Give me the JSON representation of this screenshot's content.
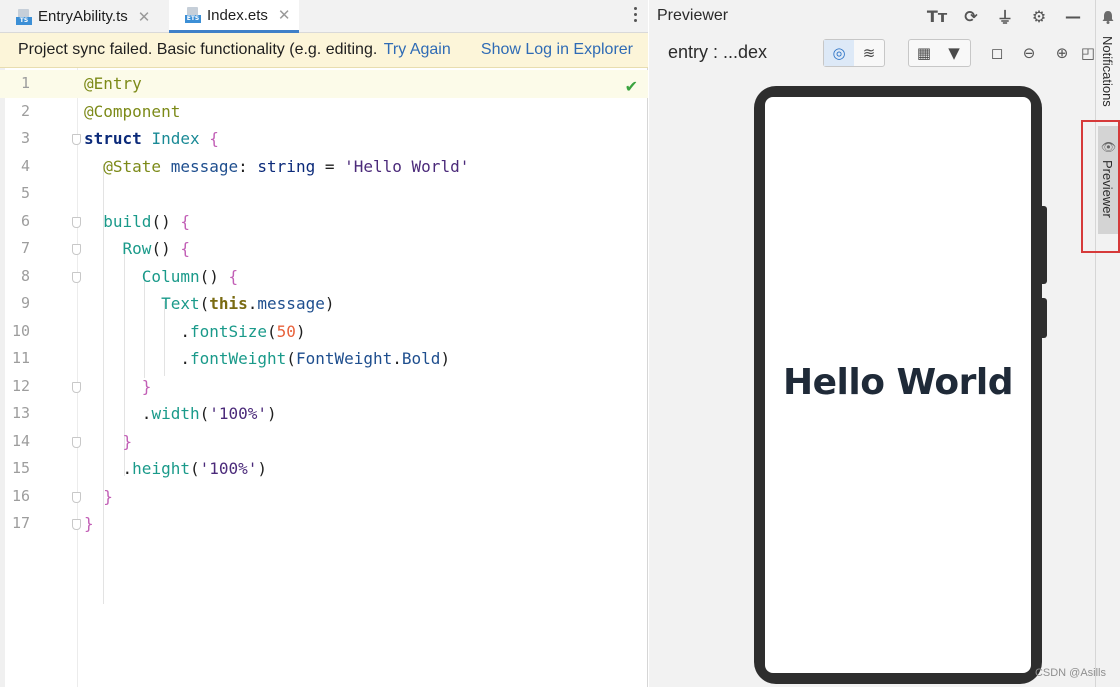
{
  "editor": {
    "tabs": [
      {
        "label": "EntryAbility.ts",
        "badge": "TS",
        "active": false
      },
      {
        "label": "Index.ets",
        "badge": "ETS",
        "active": true
      }
    ],
    "banner": {
      "message": "Project sync failed. Basic functionality (e.g. editing.",
      "try_again": "Try Again",
      "show_log": "Show Log in Explorer"
    },
    "line_numbers": [
      "1",
      "2",
      "3",
      "4",
      "5",
      "6",
      "7",
      "8",
      "9",
      "10",
      "11",
      "12",
      "13",
      "14",
      "15",
      "16",
      "17"
    ]
  },
  "previewer": {
    "title": "Previewer",
    "entry_label": "entry : ...dex",
    "screen_text": "Hello World"
  },
  "right_strip": {
    "notifications_label": "Notifications",
    "previewer_label": "Previewer"
  },
  "watermark": "CSDN @Asills",
  "colors": {
    "accent": "#3f80c8",
    "banner_bg": "#fcf5d9",
    "link": "#2f6bb5",
    "highlight_box": "#d63a3a"
  }
}
